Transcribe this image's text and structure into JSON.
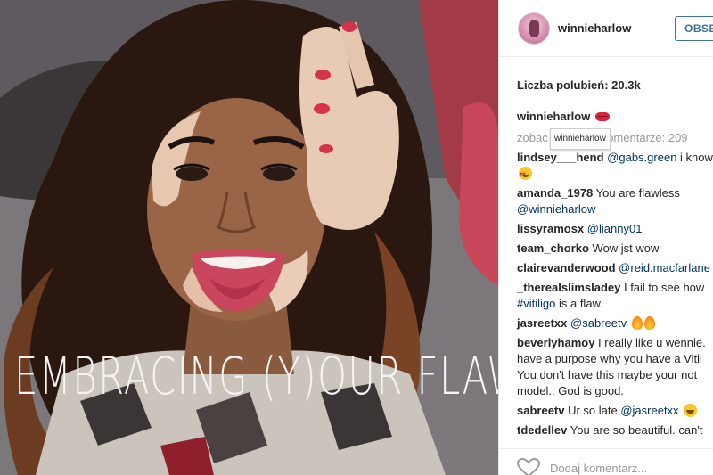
{
  "photo": {
    "caption": "EMBRACING (Y)OUR FLAWS"
  },
  "header": {
    "username": "winnieharlow",
    "follow_label": "OBSE"
  },
  "likes_text": "Liczba polubień: 20.3k",
  "caption": {
    "user": "winnieharlow"
  },
  "view_all": {
    "prefix": "zobac",
    "suffix": "komentarze: 209",
    "tooltip": "winnieharlow"
  },
  "comments": [
    {
      "user": "lindsey___hend",
      "mention": "@gabs.green",
      "text": " i know",
      "line2": ""
    },
    {
      "user": "amanda_1978",
      "mention": "",
      "text": " You are flawless",
      "line2": "@winnieharlow"
    },
    {
      "user": "lissyramosx",
      "mention": "@lianny01",
      "text": "",
      "line2": ""
    },
    {
      "user": "team_chorko",
      "mention": "",
      "text": " Wow jst wow",
      "line2": ""
    },
    {
      "user": "clairevanderwood",
      "mention": "@reid.macfarlane",
      "text": "",
      "line2": ""
    },
    {
      "user": "_therealslimsladey",
      "mention": "",
      "text": " I fail to see how",
      "line2": "#vitiligo",
      "line2b": " is a flaw."
    },
    {
      "user": "jasreetxx",
      "mention": "@sabreetv",
      "text": "",
      "line2": ""
    },
    {
      "user": "beverlyhamoy",
      "mention": "",
      "text": " I really like u wennie.",
      "line2": "have a purpose why you have a Vitil",
      "line3": "You don't have this maybe your not",
      "line4": "model.. God is good."
    },
    {
      "user": "sabreetv",
      "mention": "",
      "text": " Ur so late ",
      "mention2": "@jasreetxx",
      "line2": ""
    },
    {
      "user": "tdedellev",
      "mention": "",
      "text": " You are so beautiful. can't",
      "line2": ""
    }
  ],
  "footer": {
    "add_comment_placeholder": "Dodaj komentarz..."
  },
  "colors": {
    "link": "#003569",
    "follow": "#3f729b",
    "muted": "#999999"
  }
}
